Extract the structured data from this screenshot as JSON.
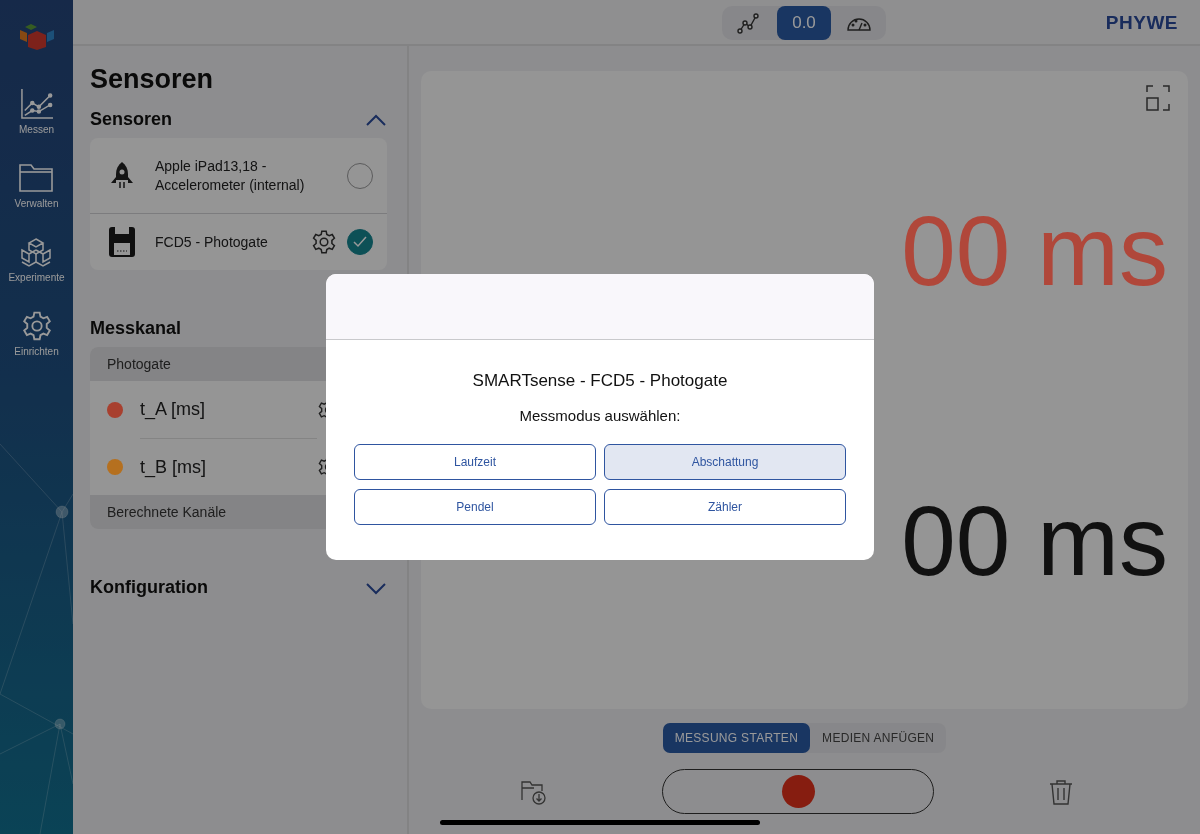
{
  "rail": {
    "items": [
      {
        "kind": "chart",
        "label": "Messen"
      },
      {
        "kind": "folder",
        "label": "Verwalten"
      },
      {
        "kind": "cubes",
        "label": "Experimente"
      },
      {
        "kind": "gear",
        "label": "Einrichten"
      }
    ]
  },
  "top_bar": {
    "view_toggle": [
      {
        "kind": "graph",
        "selected": false
      },
      {
        "kind": "value",
        "label": "0.0",
        "selected": true
      },
      {
        "kind": "gauge",
        "selected": false
      }
    ],
    "brand": "PHYWE"
  },
  "sidebar": {
    "title": "Sensoren",
    "sensors": {
      "title": "Sensoren",
      "expanded": true,
      "items": [
        {
          "kind": "phone",
          "name": "Apple iPad13,18 - Accelerometer (internal)",
          "checked": false,
          "settings": false
        },
        {
          "kind": "device",
          "name": "FCD5 - Photogate",
          "checked": true,
          "settings": true
        }
      ]
    },
    "channels": {
      "title": "Messkanal",
      "groups": [
        {
          "label": "Photogate",
          "channels": [
            {
              "name": "t_A [ms]",
              "color": "#a8402f"
            },
            {
              "name": "t_B [ms]",
              "color": "#b5701f"
            }
          ]
        },
        {
          "label": "Berechnete Kanäle"
        }
      ]
    },
    "configuration": {
      "title": "Konfiguration",
      "expanded": false
    }
  },
  "main": {
    "readouts": [
      {
        "value": "00 ms",
        "color": "#b0473a"
      },
      {
        "value": "00 ms",
        "color": "#111111"
      }
    ],
    "tabs": [
      {
        "label": "MESSUNG STARTEN",
        "selected": true
      },
      {
        "label": "MEDIEN ANFÜGEN",
        "selected": false
      }
    ]
  },
  "dialog": {
    "title": "SMARTsense - FCD5 - Photogate",
    "prompt": "Messmodus auswählen:",
    "options": [
      {
        "label": "Laufzeit",
        "selected": false
      },
      {
        "label": "Abschattung",
        "selected": true
      },
      {
        "label": "Pendel",
        "selected": false
      },
      {
        "label": "Zähler",
        "selected": false
      }
    ]
  }
}
